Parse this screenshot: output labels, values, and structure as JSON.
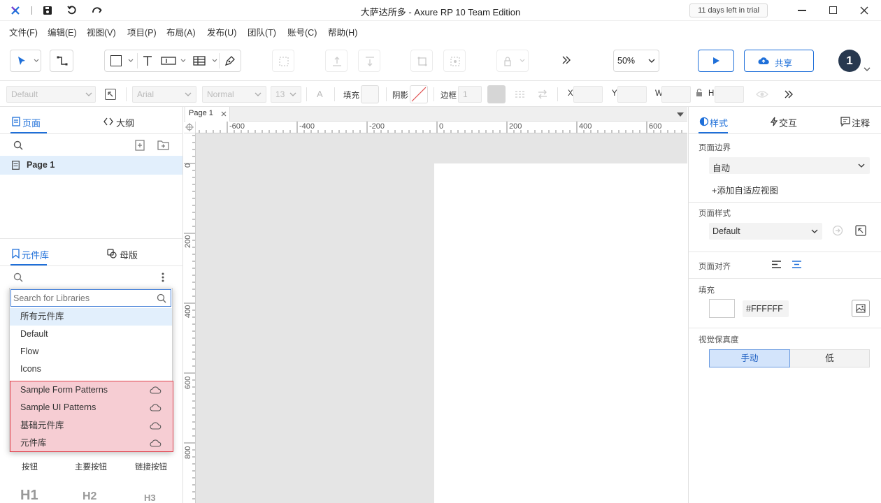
{
  "window": {
    "title": "大萨达所多 - Axure RP 10 Team Edition",
    "trial_badge": "11 days left in trial"
  },
  "menu": [
    "文件(F)",
    "编辑(E)",
    "视图(V)",
    "项目(P)",
    "布局(A)",
    "发布(U)",
    "团队(T)",
    "账号(C)",
    "帮助(H)"
  ],
  "toolbar": {
    "zoom": "50%",
    "share_label": "共享",
    "user_avatar": "1"
  },
  "formatbar": {
    "style": "Default",
    "font": "Arial",
    "weight": "Normal",
    "size": "13",
    "fill_label": "填充",
    "shadow_label": "阴影",
    "border_label": "边框",
    "border_value": "1",
    "x_label": "X",
    "y_label": "Y",
    "w_label": "W",
    "h_label": "H"
  },
  "left": {
    "tabs": {
      "pages": "页面",
      "outline": "大纲"
    },
    "pages": [
      {
        "label": "Page 1"
      }
    ],
    "lib_tabs": {
      "library": "元件库",
      "masters": "母版"
    },
    "search_placeholder": "Search for Libraries",
    "dropdown_items": [
      "所有元件库",
      "Default",
      "Flow",
      "Icons"
    ],
    "cloud_items": [
      "Sample Form Patterns",
      "Sample UI Patterns",
      "基础元件库",
      "元件库"
    ],
    "widgets_row1": [
      "按钮",
      "主要按钮",
      "链接按钮"
    ],
    "widgets_row2": [
      "H1",
      "H2",
      "H3"
    ]
  },
  "canvas": {
    "tab_label": "Page 1",
    "h_ticks": [
      "-600",
      "-400",
      "-200",
      "0",
      "200",
      "400",
      "600"
    ],
    "v_ticks": [
      "0",
      "200",
      "400",
      "600",
      "800"
    ]
  },
  "right": {
    "tabs": {
      "style": "样式",
      "interact": "交互",
      "notes": "注释"
    },
    "page_dimension_label": "页面边界",
    "page_dimension_value": "自动",
    "add_adaptive": "添加自适应视图",
    "page_style_label": "页面样式",
    "page_style_value": "Default",
    "align_label": "页面对齐",
    "fill_label": "填充",
    "fill_value": "#FFFFFF",
    "fidelity_label": "视觉保真度",
    "fidelity_manual": "手动",
    "fidelity_low": "低"
  },
  "colors": {
    "accent": "#1e6fd9",
    "highlight_fill": "#f6cdd3",
    "highlight_border": "#e0444f",
    "canvas_bg": "#e5e5e5"
  }
}
